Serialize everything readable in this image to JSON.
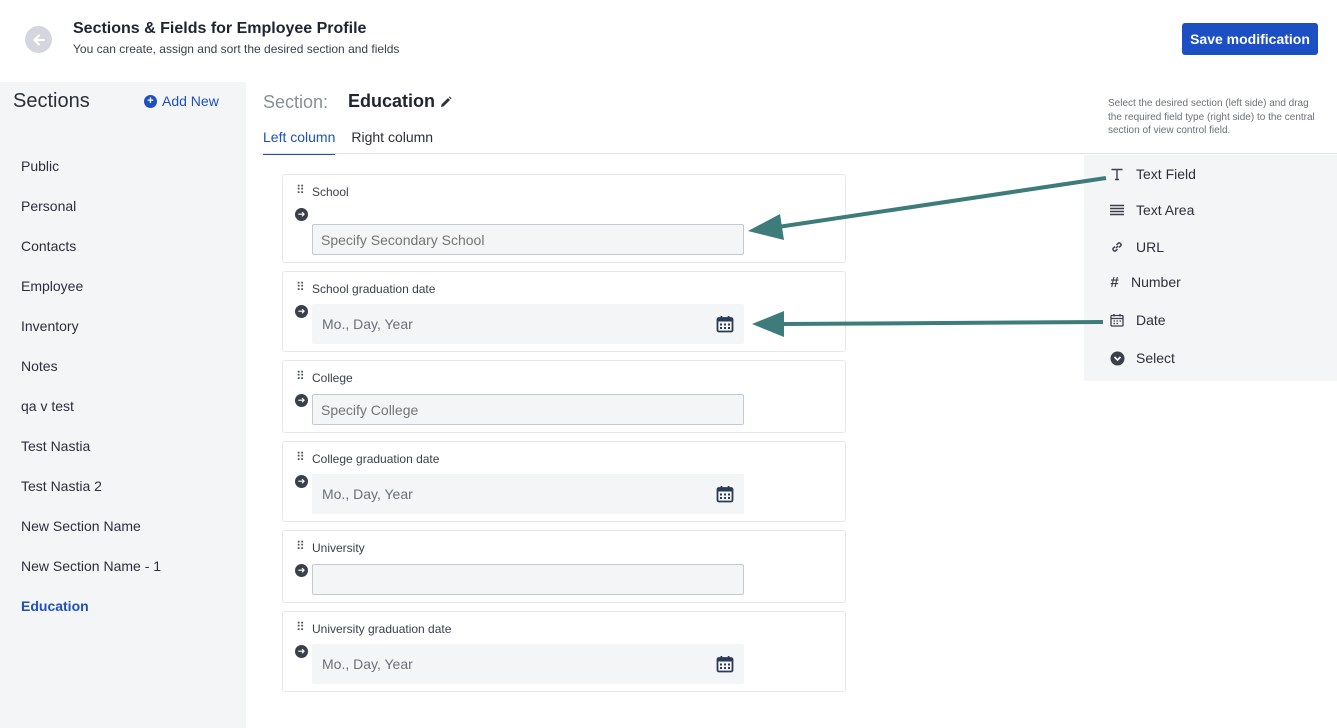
{
  "header": {
    "title": "Sections & Fields for Employee Profile",
    "subtitle": "You can create, assign and sort the desired section and fields",
    "save_label": "Save modification"
  },
  "sidebar": {
    "title": "Sections",
    "add_new_label": "Add New",
    "items": [
      {
        "label": "Public"
      },
      {
        "label": "Personal"
      },
      {
        "label": "Contacts"
      },
      {
        "label": "Employee"
      },
      {
        "label": "Inventory"
      },
      {
        "label": "Notes"
      },
      {
        "label": "qa v test"
      },
      {
        "label": "Test Nastia"
      },
      {
        "label": "Test Nastia 2"
      },
      {
        "label": "New Section Name"
      },
      {
        "label": "New Section Name - 1"
      },
      {
        "label": "Education",
        "active": true
      }
    ]
  },
  "section": {
    "label": "Section:",
    "name": "Education",
    "tabs": [
      {
        "label": "Left column",
        "active": true
      },
      {
        "label": "Right column"
      }
    ]
  },
  "fields": [
    {
      "label": "School",
      "type": "text",
      "placeholder": "Specify Secondary School"
    },
    {
      "label": "School graduation date",
      "type": "date",
      "placeholder": "Mo., Day, Year"
    },
    {
      "label": "College",
      "type": "text",
      "placeholder": "Specify College"
    },
    {
      "label": "College graduation date",
      "type": "date",
      "placeholder": "Mo., Day, Year"
    },
    {
      "label": "University",
      "type": "text",
      "placeholder": ""
    },
    {
      "label": "University graduation date",
      "type": "date",
      "placeholder": "Mo., Day, Year"
    }
  ],
  "panel": {
    "hint": "Select the desired section (left side) and drag the required field type (right side) to the central section of view control field.",
    "types": [
      {
        "label": "Text Field",
        "icon": "text-t-icon"
      },
      {
        "label": "Text Area",
        "icon": "text-area-lines-icon"
      },
      {
        "label": "URL",
        "icon": "link-icon"
      },
      {
        "label": "Number",
        "icon": "hash-icon"
      },
      {
        "label": "Date",
        "icon": "calendar-icon"
      },
      {
        "label": "Select",
        "icon": "chevron-circle-icon"
      }
    ]
  },
  "colors": {
    "accent": "#1d4fc4",
    "annotation_arrow": "#3e7c7b"
  }
}
